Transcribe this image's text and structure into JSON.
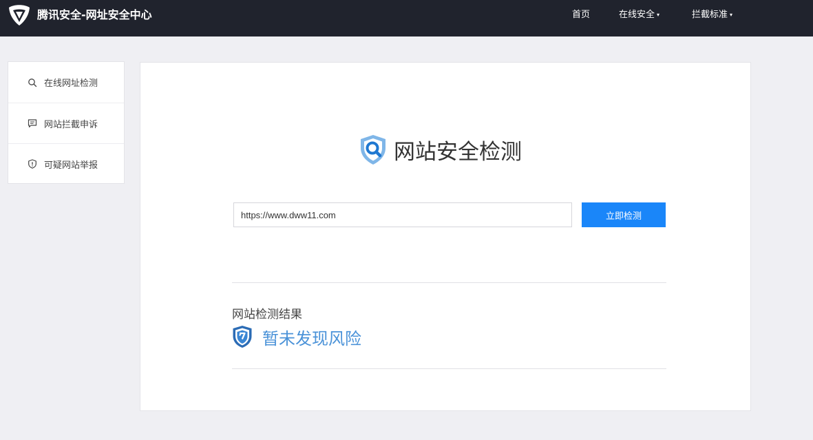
{
  "header": {
    "brand_title": "腾讯安全-网址安全中心",
    "nav": [
      {
        "label": "首页",
        "has_dropdown": false
      },
      {
        "label": "在线安全",
        "has_dropdown": true
      },
      {
        "label": "拦截标准",
        "has_dropdown": true
      }
    ],
    "dropdown_caret": "▾"
  },
  "sidebar": {
    "items": [
      {
        "label": "在线网址检测",
        "icon": "search-icon"
      },
      {
        "label": "网站拦截申诉",
        "icon": "message-icon"
      },
      {
        "label": "可疑网站举报",
        "icon": "shield-alert-icon"
      }
    ]
  },
  "main": {
    "heading": "网站安全检测",
    "url_input_value": "https://www.dww11.com",
    "detect_button_label": "立即检测",
    "result_label": "网站检测结果",
    "result_status": "暂未发现风险"
  },
  "colors": {
    "header_bg": "#20232d",
    "page_bg": "#efeff3",
    "accent": "#1a86f9",
    "result_text": "#4a92d8"
  }
}
